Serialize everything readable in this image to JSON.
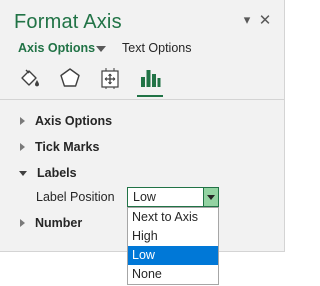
{
  "pane": {
    "title": "Format Axis",
    "pin_glyph": "▾",
    "close_glyph": "✕"
  },
  "option_tabs": [
    {
      "label": "Axis Options",
      "active": true
    },
    {
      "label": "Text Options",
      "active": false
    }
  ],
  "icon_tabs": [
    {
      "name": "fill-line-icon"
    },
    {
      "name": "effects-icon"
    },
    {
      "name": "size-properties-icon"
    },
    {
      "name": "axis-options-icon",
      "selected": true
    }
  ],
  "sections": [
    {
      "label": "Axis Options",
      "expanded": false
    },
    {
      "label": "Tick Marks",
      "expanded": false
    },
    {
      "label": "Labels",
      "expanded": true
    },
    {
      "label": "Number",
      "expanded": false
    }
  ],
  "labels": {
    "position_label": "Label Position",
    "selected_value": "Low",
    "options": [
      "Next to Axis",
      "High",
      "Low",
      "None"
    ]
  },
  "colors": {
    "accent": "#217346",
    "selection": "#0078d7",
    "dropdown_arrow_bg": "#93d3a2"
  }
}
